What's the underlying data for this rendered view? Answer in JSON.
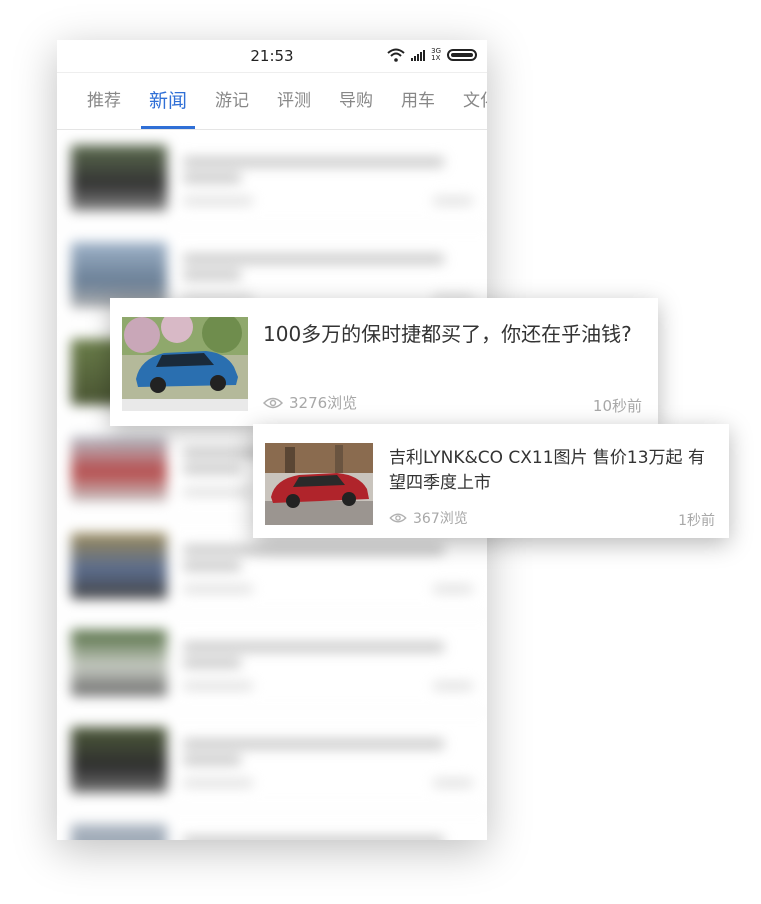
{
  "status_bar": {
    "time": "21:53",
    "network_top": "3G",
    "network_bottom": "1X"
  },
  "tabs": [
    {
      "label": "推荐"
    },
    {
      "label": "新闻"
    },
    {
      "label": "游记"
    },
    {
      "label": "评测"
    },
    {
      "label": "导购"
    },
    {
      "label": "用车"
    },
    {
      "label": "文化技"
    }
  ],
  "active_tab": "新闻",
  "colors": {
    "accent": "#2f6fd6",
    "meta_text": "#a8a8a8",
    "title_text": "#333333"
  },
  "featured_articles": [
    {
      "title": "100多万的保时捷都买了，你还在乎油钱?",
      "views": "3276浏览",
      "time": "10秒前",
      "image": "blue-sports-coupe"
    },
    {
      "title": "吉利LYNK&CO CX11图片  售价13万起 有望四季度上市",
      "views": "367浏览",
      "time": "1秒前",
      "image": "red-sedan"
    }
  ]
}
